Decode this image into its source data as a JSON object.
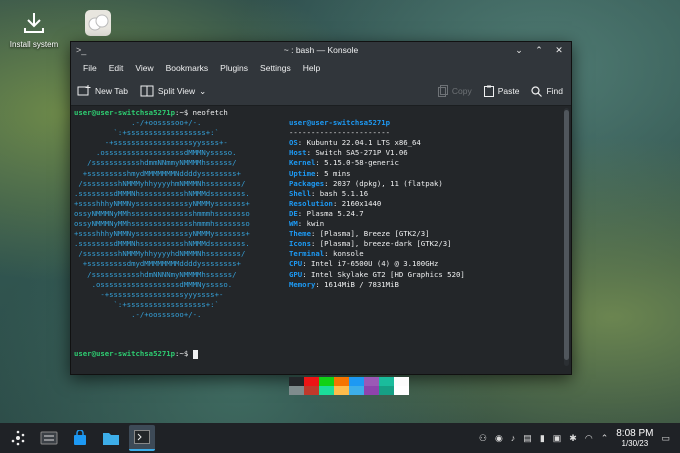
{
  "desktop": {
    "icons": [
      {
        "label": "Install system",
        "icon": "download-icon"
      },
      {
        "label": "",
        "icon": "steam-deck-icon"
      }
    ]
  },
  "window": {
    "title": "~ : bash — Konsole",
    "menu": [
      "File",
      "Edit",
      "View",
      "Bookmarks",
      "Plugins",
      "Settings",
      "Help"
    ],
    "toolbar": {
      "new_tab": "New Tab",
      "split_view": "Split View",
      "copy": "Copy",
      "paste": "Paste",
      "find": "Find"
    }
  },
  "terminal": {
    "prompt1": "user@user-switchsa5271p",
    "prompt_suffix": ":~$ ",
    "command1": "neofetch",
    "logo_lines": [
      "             .-/+oossssoo+/-.",
      "         `:+ssssssssssssssssss+:`",
      "       -+ssssssssssssssssssyyssss+-",
      "     .ossssssssssssssssssdMMMNysssso.",
      "   /ssssssssssshdmmNNmmyNMMMMhssssss/",
      "  +ssssssssshmydMMMMMMMNddddyssssssss+",
      " /sssssssshNMMMyhhyyyyhmNMMMNhssssssss/",
      ".ssssssssdMMMNhsssssssssshNMMMdssssssss.",
      "+sssshhhyNMMNyssssssssssssyNMMMysssssss+",
      "ossyNMMMNyMMhsssssssssssssshmmmhssssssso",
      "ossyNMMMNyMMhsssssssssssssshmmmhssssssso",
      "+sssshhhyNMMNyssssssssssssyNMMMysssssss+",
      ".ssssssssdMMMNhsssssssssshNMMMdssssssss.",
      " /sssssssshNMMMyhhyyyyhdNMMMNhssssssss/",
      "  +sssssssssdmydMMMMMMMMddddyssssssss+",
      "   /ssssssssssshdmNNNNmyNMMMMhssssss/",
      "    .ossssssssssssssssssdMMMNysssso.",
      "      -+sssssssssssssssssyyyssss+-",
      "         `:+ssssssssssssssssss+:`",
      "             .-/+oossssoo+/-."
    ],
    "info_header": "user@user-switchsa5271p",
    "info_sep": "-----------------------",
    "info": [
      {
        "k": "OS",
        "v": "Kubuntu 22.04.1 LTS x86_64"
      },
      {
        "k": "Host",
        "v": "Switch SA5-271P V1.06"
      },
      {
        "k": "Kernel",
        "v": "5.15.0-58-generic"
      },
      {
        "k": "Uptime",
        "v": "5 mins"
      },
      {
        "k": "Packages",
        "v": "2037 (dpkg), 11 (flatpak)"
      },
      {
        "k": "Shell",
        "v": "bash 5.1.16"
      },
      {
        "k": "Resolution",
        "v": "2160x1440"
      },
      {
        "k": "DE",
        "v": "Plasma 5.24.7"
      },
      {
        "k": "WM",
        "v": "kwin"
      },
      {
        "k": "Theme",
        "v": "[Plasma], Breeze [GTK2/3]"
      },
      {
        "k": "Icons",
        "v": "[Plasma], breeze-dark [GTK2/3]"
      },
      {
        "k": "Terminal",
        "v": "konsole"
      },
      {
        "k": "CPU",
        "v": "Intel i7-6500U (4) @ 3.100GHz"
      },
      {
        "k": "GPU",
        "v": "Intel Skylake GT2 [HD Graphics 520]"
      },
      {
        "k": "Memory",
        "v": "1614MiB / 7831MiB"
      }
    ],
    "swatch_row1": [
      "#232629",
      "#ed1515",
      "#11d116",
      "#f67400",
      "#1d99f3",
      "#9b59b6",
      "#1abc9c",
      "#fcfcfc"
    ],
    "swatch_row2": [
      "#7f8c8d",
      "#c0392b",
      "#1cdc9a",
      "#fdbc4b",
      "#3daee9",
      "#8e44ad",
      "#16a085",
      "#ffffff"
    ],
    "prompt2": "user@user-switchsa5271p",
    "prompt2_suffix": ":~$ "
  },
  "taskbar": {
    "clock_time": "8:08 PM",
    "clock_date": "1/30/23"
  },
  "colors": {
    "accent": "#3daee9",
    "prompt_green": "#2ecc71",
    "info_key_blue": "#1d99f3"
  }
}
